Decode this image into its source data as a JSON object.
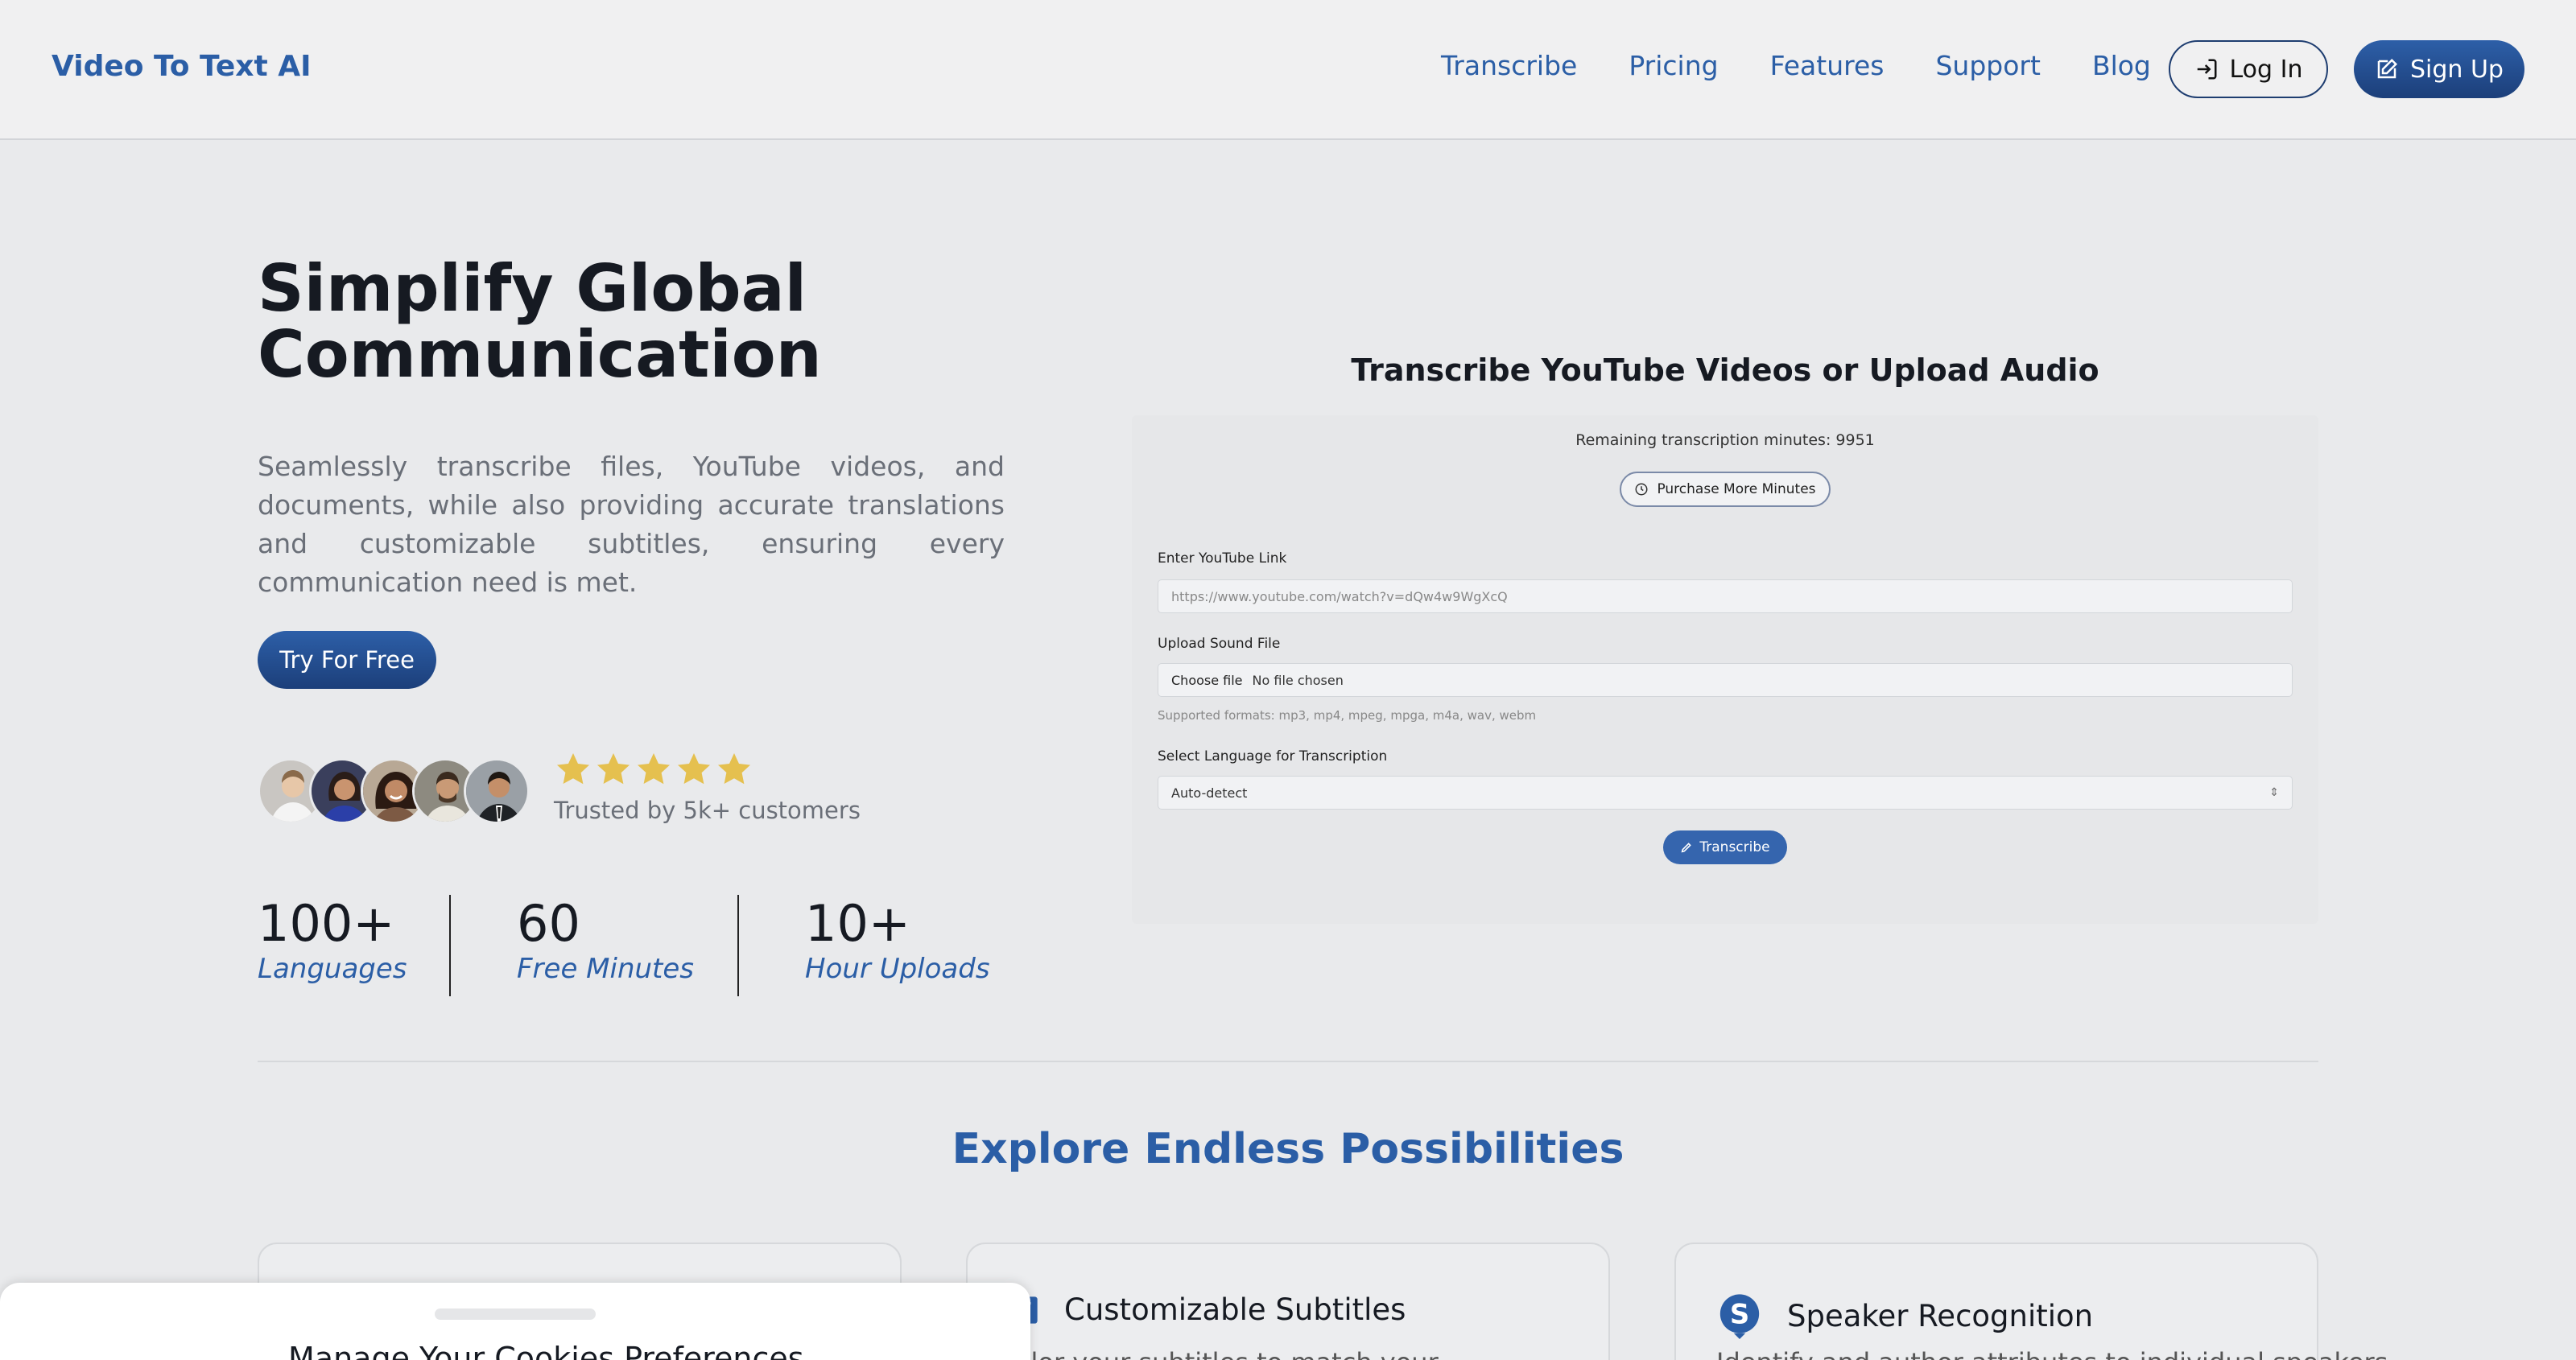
{
  "header": {
    "brand": "Video To Text AI",
    "nav": [
      "Transcribe",
      "Pricing",
      "Features",
      "Support",
      "Blog"
    ],
    "login_label": "Log In",
    "signup_label": "Sign Up"
  },
  "hero": {
    "title_line1": "Simplify Global",
    "title_line2": "Communication",
    "description": "Seamlessly transcribe files, YouTube videos, and documents, while also providing accurate translations and customizable subtitles, ensuring every communication need is met.",
    "cta_label": "Try For Free",
    "rating_stars": 5,
    "trusted_text": "Trusted by 5k+ customers",
    "stats": [
      {
        "value": "100+",
        "label": "Languages"
      },
      {
        "value": "60",
        "label": "Free Minutes"
      },
      {
        "value": "10+",
        "label": "Hour Uploads"
      }
    ]
  },
  "transcriber": {
    "title": "Transcribe YouTube Videos or Upload Audio",
    "remaining": "Remaining transcription minutes: 9951",
    "purchase_label": "Purchase More Minutes",
    "youtube_label": "Enter YouTube Link",
    "youtube_placeholder": "https://www.youtube.com/watch?v=dQw4w9WgXcQ",
    "upload_label": "Upload Sound File",
    "choose_file_label": "Choose file",
    "file_status": "No file chosen",
    "formats": "Supported formats: mp3, mp4, mpeg, mpga, m4a, wav, webm",
    "language_label": "Select Language for Transcription",
    "language_value": "Auto-detect",
    "transcribe_label": "Transcribe"
  },
  "features": {
    "title": "Explore Endless Possibilities",
    "cards": [
      {
        "title": "",
        "icon": "blank",
        "desc": ""
      },
      {
        "title": "Customizable Subtitles",
        "icon": "translate-icon",
        "desc": "ailor your subtitles to match your"
      },
      {
        "title": "Speaker Recognition",
        "icon": "speaker-s-icon",
        "desc": "Identify and author attributes to individual speakers"
      }
    ]
  },
  "cookie": {
    "title": "Manage Your Cookies Preferences"
  },
  "colors": {
    "accent": "#2b5ea6",
    "accent_dark": "#1c3f7a",
    "star": "#e5c04f",
    "background": "#e9eaec"
  }
}
